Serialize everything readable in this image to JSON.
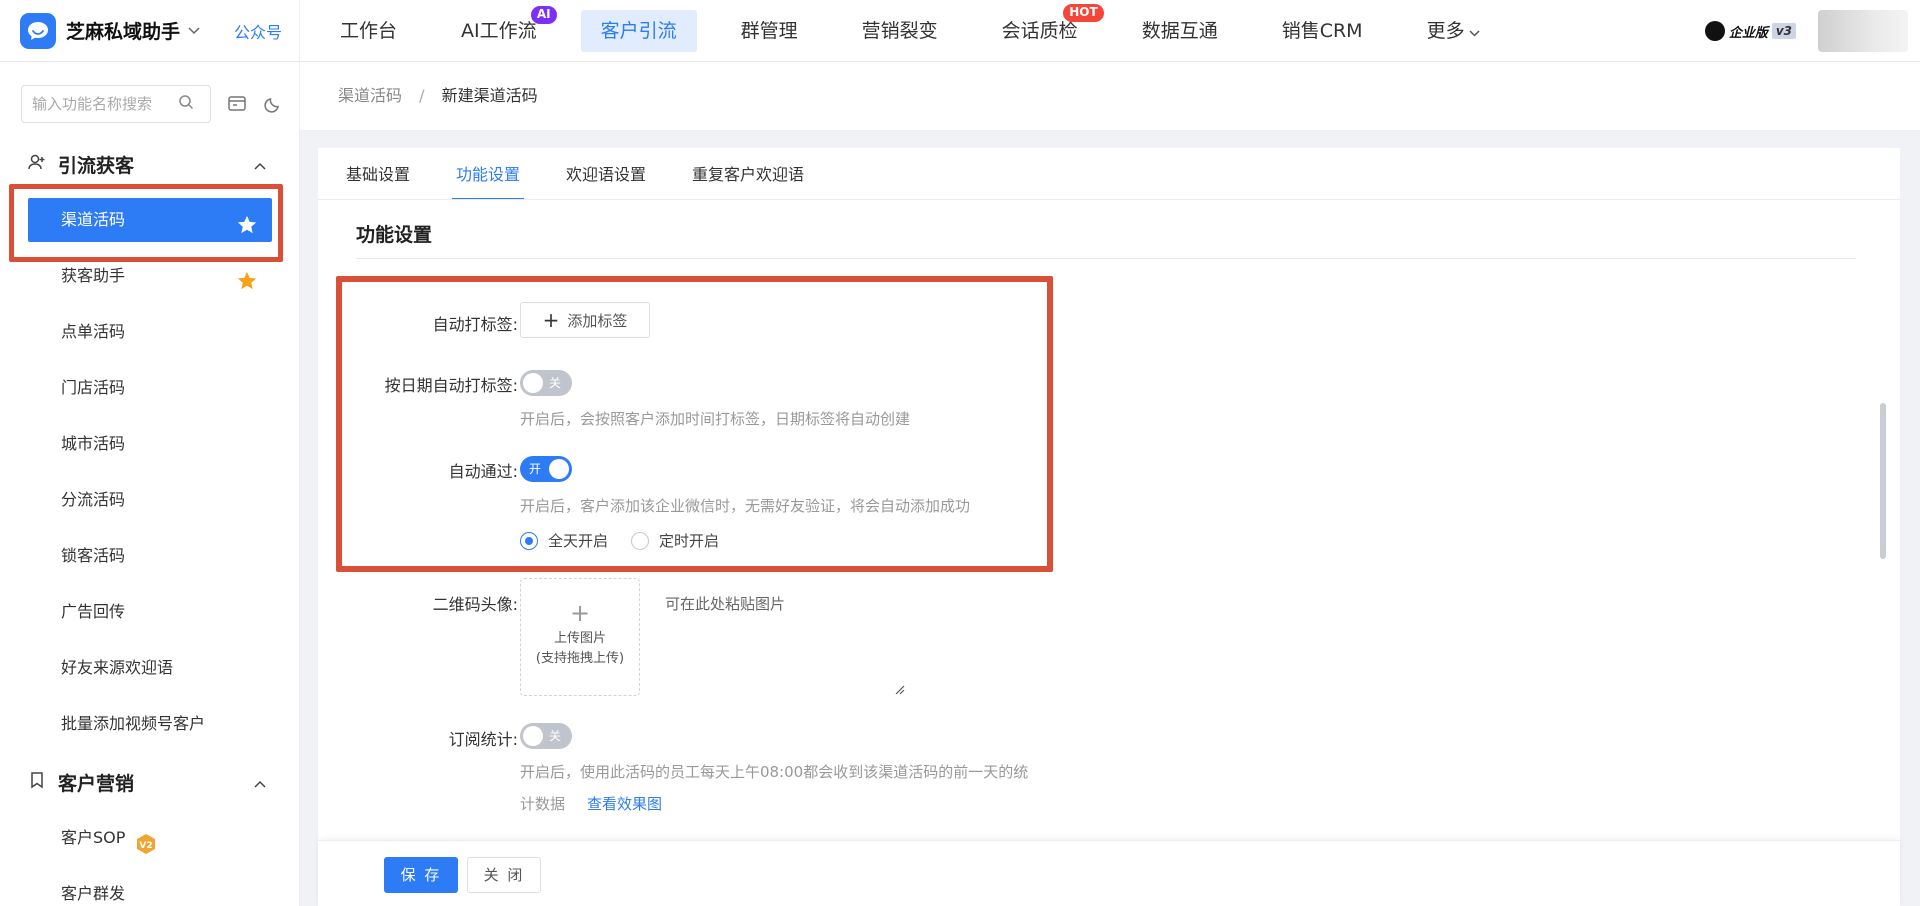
{
  "app": {
    "name": "芝麻私域助手",
    "public_account": "公众号",
    "edition": "企业版",
    "version": "v3"
  },
  "nav": {
    "items": [
      {
        "label": "工作台"
      },
      {
        "label": "AI工作流",
        "badge": "AI"
      },
      {
        "label": "客户引流",
        "active": true
      },
      {
        "label": "群管理"
      },
      {
        "label": "营销裂变"
      },
      {
        "label": "会话质检",
        "badge": "HOT"
      },
      {
        "label": "数据互通"
      },
      {
        "label": "销售CRM"
      },
      {
        "label": "更多"
      }
    ]
  },
  "sidebar": {
    "search_placeholder": "输入功能名称搜索",
    "groups": [
      {
        "title": "引流获客",
        "items": [
          {
            "label": "渠道活码",
            "active": true,
            "starred": true
          },
          {
            "label": "获客助手",
            "starred": true
          },
          {
            "label": "点单活码"
          },
          {
            "label": "门店活码"
          },
          {
            "label": "城市活码"
          },
          {
            "label": "分流活码"
          },
          {
            "label": "锁客活码"
          },
          {
            "label": "广告回传"
          },
          {
            "label": "好友来源欢迎语"
          },
          {
            "label": "批量添加视频号客户"
          }
        ]
      },
      {
        "title": "客户营销",
        "items": [
          {
            "label": "客户SOP",
            "badge": "V2"
          },
          {
            "label": "客户群发"
          }
        ]
      }
    ]
  },
  "breadcrumb": {
    "parent": "渠道活码",
    "separator": "/",
    "current": "新建渠道活码"
  },
  "tabs": [
    {
      "label": "基础设置"
    },
    {
      "label": "功能设置",
      "active": true
    },
    {
      "label": "欢迎语设置"
    },
    {
      "label": "重复客户欢迎语"
    }
  ],
  "form": {
    "section_title": "功能设置",
    "auto_tag": {
      "label": "自动打标签:",
      "button": "添加标签"
    },
    "date_tag": {
      "label": "按日期自动打标签:",
      "state": "关",
      "on": false,
      "hint": "开启后，会按照客户添加时间打标签，日期标签将自动创建"
    },
    "auto_pass": {
      "label": "自动通过:",
      "state": "开",
      "on": true,
      "hint": "开启后，客户添加该企业微信时，无需好友验证，将会自动添加成功"
    },
    "pass_mode": {
      "options": [
        "全天开启",
        "定时开启"
      ],
      "selected": "全天开启"
    },
    "qr_avatar": {
      "label": "二维码头像:",
      "upload_line1": "上传图片",
      "upload_line2": "(支持拖拽上传)",
      "paste_text": "可在此处粘贴图片"
    },
    "subscribe": {
      "label": "订阅统计:",
      "state": "关",
      "on": false,
      "hint_line1": "开启后，使用此活码的员工每天上午08:00都会收到该渠道活码的前一天的统",
      "hint_line2": "计数据",
      "link": "查看效果图"
    }
  },
  "footer": {
    "save": "保 存",
    "close": "关 闭"
  },
  "colors": {
    "accent": "#2d7cf6",
    "highlight": "#d94f37",
    "hot": "#f5463a",
    "ai": "#7b2ff7"
  }
}
